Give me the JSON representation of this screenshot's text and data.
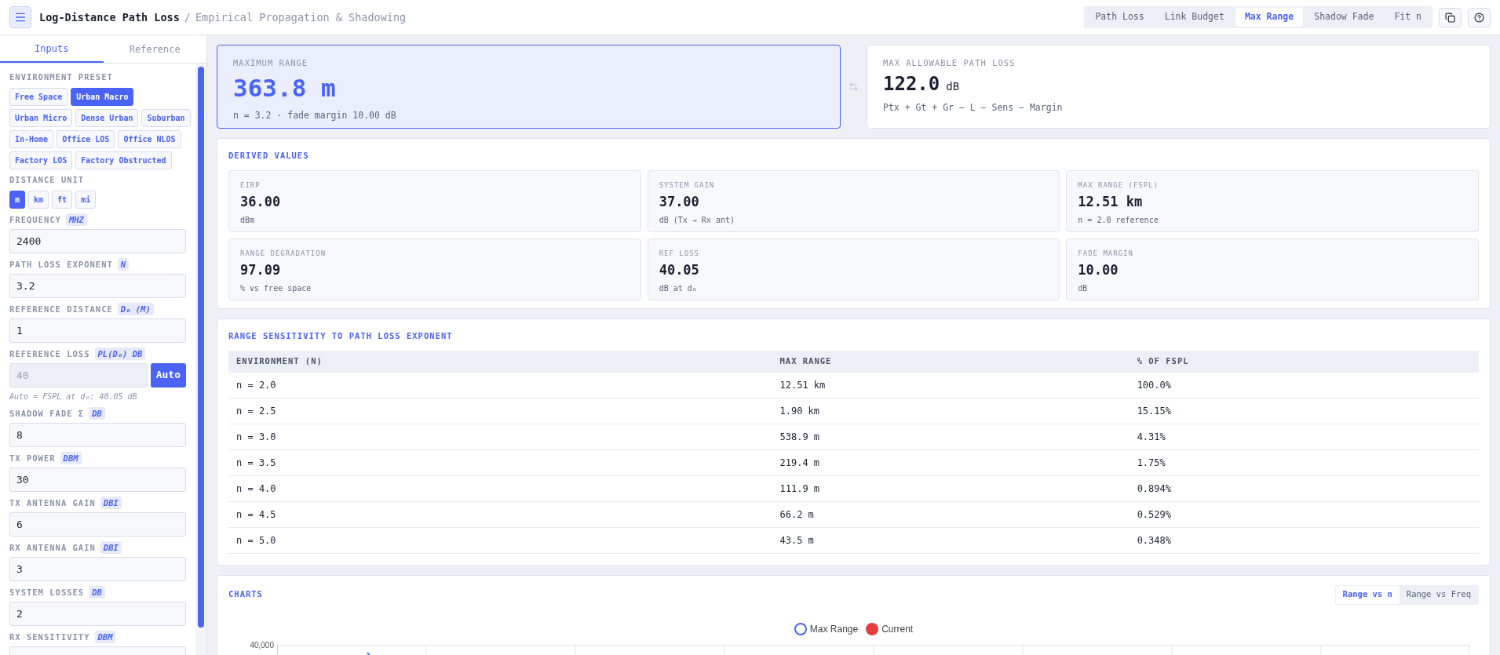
{
  "header": {
    "title": "Log-Distance Path Loss",
    "separator": "/",
    "subtitle": "Empirical Propagation & Shadowing",
    "tabs": [
      {
        "label": "Path Loss",
        "selected": false
      },
      {
        "label": "Link Budget",
        "selected": false
      },
      {
        "label": "Max Range",
        "selected": true
      },
      {
        "label": "Shadow Fade",
        "selected": false
      },
      {
        "label": "Fit n",
        "selected": false
      }
    ]
  },
  "sidebar": {
    "tabs": [
      {
        "label": "Inputs",
        "selected": true
      },
      {
        "label": "Reference",
        "selected": false
      }
    ],
    "preset": {
      "label": "ENVIRONMENT PRESET",
      "options": [
        {
          "label": "Free Space",
          "selected": false
        },
        {
          "label": "Urban Macro",
          "selected": true
        },
        {
          "label": "Urban Micro",
          "selected": false
        },
        {
          "label": "Dense Urban",
          "selected": false
        },
        {
          "label": "Suburban",
          "selected": false
        },
        {
          "label": "In-Home",
          "selected": false
        },
        {
          "label": "Office LOS",
          "selected": false
        },
        {
          "label": "Office NLOS",
          "selected": false
        },
        {
          "label": "Factory LOS",
          "selected": false
        },
        {
          "label": "Factory Obstructed",
          "selected": false
        }
      ]
    },
    "unit": {
      "label": "DISTANCE UNIT",
      "options": [
        {
          "label": "m",
          "selected": true
        },
        {
          "label": "km",
          "selected": false
        },
        {
          "label": "ft",
          "selected": false
        },
        {
          "label": "mi",
          "selected": false
        }
      ]
    },
    "fields": [
      {
        "label": "FREQUENCY",
        "unit": "MHZ",
        "value": "2400",
        "disabled": false
      },
      {
        "label": "PATH LOSS EXPONENT",
        "unit": "N",
        "value": "3.2",
        "disabled": false
      },
      {
        "label": "REFERENCE DISTANCE",
        "unit": "D₀ (M)",
        "value": "1",
        "disabled": false
      },
      {
        "label": "REFERENCE LOSS",
        "unit": "PL(D₀) DB",
        "value": "40",
        "disabled": true,
        "button": {
          "label": "Auto",
          "selected": true
        },
        "hint": "Auto = FSPL at d₀: 40.05 dB"
      },
      {
        "label": "SHADOW FADE Σ",
        "unit": "DB",
        "value": "8",
        "disabled": false
      },
      {
        "label": "TX POWER",
        "unit": "DBM",
        "value": "30",
        "disabled": false
      },
      {
        "label": "TX ANTENNA GAIN",
        "unit": "DBI",
        "value": "6",
        "disabled": false
      },
      {
        "label": "RX ANTENNA GAIN",
        "unit": "DBI",
        "value": "3",
        "disabled": false
      },
      {
        "label": "SYSTEM LOSSES",
        "unit": "DB",
        "value": "2",
        "disabled": false
      },
      {
        "label": "RX SENSITIVITY",
        "unit": "DBM"
      }
    ]
  },
  "hero": [
    {
      "kind": "primary",
      "label": "MAXIMUM RANGE",
      "value": "363.8 m",
      "note": "n = 3.2 · fade margin 10.00 dB"
    },
    {
      "kind": "secondary",
      "label": "MAX ALLOWABLE PATH LOSS",
      "value": "122.0",
      "unit": "dB",
      "note": "Ptx + Gt + Gr − L − Sens − Margin"
    }
  ],
  "derived": {
    "title": "DERIVED VALUES",
    "tiles": [
      {
        "label": "EIRP",
        "value": "36.00",
        "note": "dBm"
      },
      {
        "label": "SYSTEM GAIN",
        "value": "37.00",
        "note": "dB (Tx → Rx ant)"
      },
      {
        "label": "MAX RANGE (FSPL)",
        "value": "12.51 km",
        "note": "n = 2.0 reference"
      },
      {
        "label": "RANGE DEGRADATION",
        "value": "97.09",
        "note": "% vs free space"
      },
      {
        "label": "REF LOSS",
        "value": "40.05",
        "note": "dB at d₀"
      },
      {
        "label": "FADE MARGIN",
        "value": "10.00",
        "note": "dB"
      }
    ]
  },
  "sensitivity": {
    "title": "RANGE SENSITIVITY TO PATH LOSS EXPONENT",
    "columns": [
      "ENVIRONMENT (N)",
      "MAX RANGE",
      "% OF FSPL"
    ],
    "rows": [
      [
        "n = 2.0",
        "12.51 km",
        "100.0%"
      ],
      [
        "n = 2.5",
        "1.90 km",
        "15.15%"
      ],
      [
        "n = 3.0",
        "538.9 m",
        "4.31%"
      ],
      [
        "n = 3.5",
        "219.4 m",
        "1.75%"
      ],
      [
        "n = 4.0",
        "111.9 m",
        "0.894%"
      ],
      [
        "n = 4.5",
        "66.2 m",
        "0.529%"
      ],
      [
        "n = 5.0",
        "43.5 m",
        "0.348%"
      ]
    ]
  },
  "charts": {
    "title": "CHARTS",
    "tabs": [
      {
        "label": "Range vs n",
        "selected": true
      },
      {
        "label": "Range vs Freq",
        "selected": false
      }
    ],
    "legend": [
      {
        "label": "Max Range",
        "kind": "hollow",
        "color": "#4a63f5"
      },
      {
        "label": "Current",
        "kind": "filled",
        "color": "#e53e3e"
      }
    ],
    "y_tick_labels": [
      "40,000"
    ]
  }
}
